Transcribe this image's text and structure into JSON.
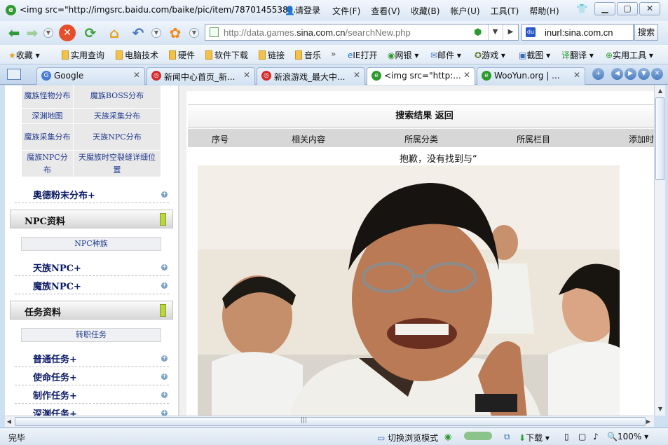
{
  "window": {
    "title": "<img src=\"http://imgsrc.baidu.com/baike/pic/item/7870145538...",
    "login": "请登录",
    "menus": [
      "文件(F)",
      "查看(V)",
      "收藏(B)",
      "帐户(U)",
      "工具(T)",
      "帮助(H)"
    ]
  },
  "nav": {
    "url_prefix": "http://data.games.",
    "url_domain": "sina.com.cn",
    "url_suffix": "/searchNew.php",
    "search_value": "inurl:sina.com.cn",
    "search_button": "搜索"
  },
  "bookmarks": [
    "收藏",
    "实用查询",
    "电脑技术",
    "硬件",
    "软件下载",
    "链接",
    "音乐",
    "IE打开",
    "网银",
    "邮件",
    "游戏",
    "截图",
    "翻译",
    "实用工具"
  ],
  "tabs": [
    {
      "title": "Google",
      "icon": "google-icon",
      "color": "#4a7bd6"
    },
    {
      "title": "新闻中心首页_新...",
      "icon": "weibo-icon",
      "color": "#d62b2b"
    },
    {
      "title": "新浪游戏_最大中...",
      "icon": "weibo-icon",
      "color": "#d62b2b"
    },
    {
      "title": "<img src=\"http:...",
      "icon": "page-icon",
      "color": "#2e9a2e"
    },
    {
      "title": "WooYun.org | ...",
      "icon": "page-icon",
      "color": "#2e9a2e"
    }
  ],
  "sidebar": {
    "grid": [
      [
        "魔族怪物分布",
        "魔族BOSS分布"
      ],
      [
        "深渊地图",
        "天族采集分布"
      ],
      [
        "魔族采集分布",
        "天族NPC分布"
      ],
      [
        "魔族NPC分布",
        "天魔族时空裂缝详细位置"
      ]
    ],
    "link_aode": "奥德粉末分布+",
    "section_npc": "NPC资料",
    "npc_sub": "NPC种族",
    "link_tian_npc": "天族NPC+",
    "link_mo_npc": "魔族NPC+",
    "section_task": "任务资料",
    "task_sub": "转职任务",
    "tasks": [
      "普通任务+",
      "使命任务+",
      "制作任务+",
      "深渊任务+"
    ]
  },
  "main": {
    "result_title": "搜索结果 返回",
    "columns": [
      "序号",
      "相关内容",
      "所属分类",
      "所属栏目",
      "添加时"
    ],
    "sorry_text": "抱歉，没有找到与“"
  },
  "statusbar": {
    "left": "完毕",
    "mode": "切换浏览模式",
    "download": "下载",
    "zoom": "100%"
  },
  "colors": {
    "accent": "#2e9a2e",
    "link": "#0b1a66"
  }
}
